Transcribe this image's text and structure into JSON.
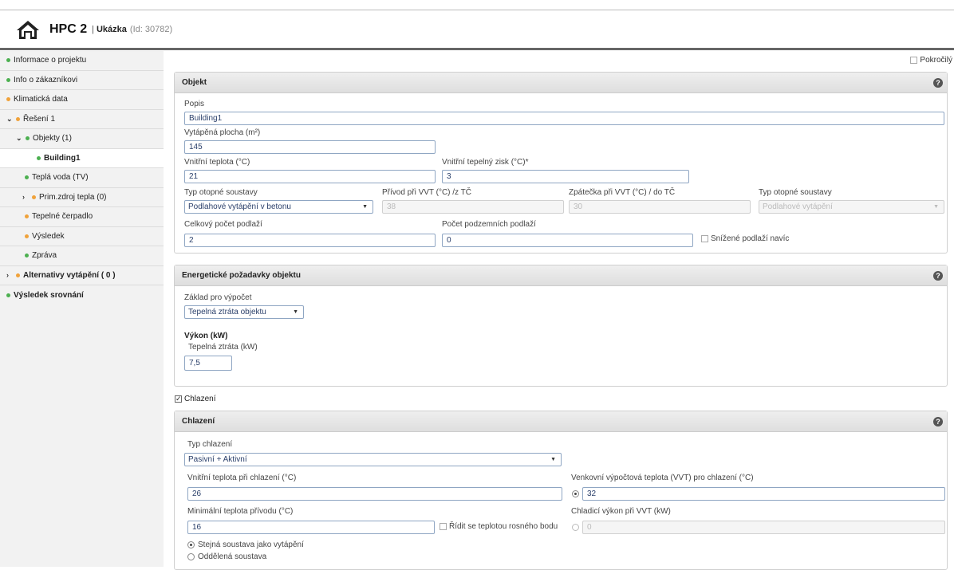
{
  "header": {
    "app_title": "HPC 2",
    "separator": "|",
    "project_name": "Ukázka",
    "project_id": "(Id: 30782)"
  },
  "sidebar": {
    "items": [
      {
        "label": "Informace o projektu",
        "dot": "green"
      },
      {
        "label": "Info o zákazníkovi",
        "dot": "green"
      },
      {
        "label": "Klimatická data",
        "dot": "orange"
      },
      {
        "label": "Řešení 1",
        "dot": "orange",
        "expanded": true
      },
      {
        "label": "Objekty (1)",
        "dot": "green",
        "expanded": true
      },
      {
        "label": "Building1",
        "dot": "green",
        "selected": true
      },
      {
        "label": "Teplá voda (TV)",
        "dot": "green"
      },
      {
        "label": "Prim.zdroj tepla (0)",
        "dot": "orange",
        "expanded": false
      },
      {
        "label": "Tepelné čerpadlo",
        "dot": "orange"
      },
      {
        "label": "Výsledek",
        "dot": "orange"
      },
      {
        "label": "Zpráva",
        "dot": "green"
      },
      {
        "label": "Alternativy vytápění ( 0 )",
        "dot": "orange",
        "expanded": false
      },
      {
        "label": "Výsledek srovnání",
        "dot": "green"
      }
    ]
  },
  "advanced": {
    "label": "Pokročilý",
    "checked": false
  },
  "objekt": {
    "title": "Objekt",
    "popis_label": "Popis",
    "popis_value": "Building1",
    "plocha_label": "Vytápěná plocha (m²)",
    "plocha_value": "145",
    "vnitrni_teplota_label": "Vnitřní teplota (°C)",
    "vnitrni_teplota_value": "21",
    "zisk_label": "Vnitřní tepelný zisk (°C)*",
    "zisk_value": "3",
    "typ_soustavy_label": "Typ otopné soustavy",
    "typ_soustavy_value": "Podlahové vytápění v betonu",
    "privod_label": "Přívod při VVT (°C) /z TČ",
    "privod_value": "38",
    "zpatecka_label": "Zpátečka při VVT (°C) / do TČ",
    "zpatecka_value": "30",
    "typ_soustavy2_label": "Typ otopné soustavy",
    "typ_soustavy2_value": "Podlahové vytápění",
    "podlazi_label": "Celkový počet podlaží",
    "podlazi_value": "2",
    "podzemni_label": "Počet podzemních podlaží",
    "podzemni_value": "0",
    "snizene_label": "Snížené podlaží navíc",
    "snizene_checked": false
  },
  "energie": {
    "title": "Energetické požadavky objektu",
    "zaklad_label": "Základ pro výpočet",
    "zaklad_value": "Tepelná ztráta objektu",
    "vykon_label": "Výkon (kW)",
    "ztrata_label": "Tepelná ztráta (kW)",
    "ztrata_value": "7,5"
  },
  "chlazeni_toggle": {
    "label": "Chlazení",
    "checked": true
  },
  "chlazeni": {
    "title": "Chlazení",
    "typ_label": "Typ chlazení",
    "typ_value": "Pasivní + Aktivní",
    "vnitrni_label": "Vnitřní teplota při chlazení (°C)",
    "vnitrni_value": "26",
    "venkovni_label": "Venkovní výpočtová teplota (VVT) pro chlazení (°C)",
    "venkovni_value": "32",
    "min_privod_label": "Minimální teplota přívodu (°C)",
    "min_privod_value": "16",
    "ridit_label": "Řídit se teplotou rosného bodu",
    "ridit_checked": false,
    "vykon_label": "Chladicí výkon při VVT (kW)",
    "vykon_value": "0",
    "radio_stejna": "Stejná soustava jako vytápění",
    "radio_oddelena": "Oddělená soustava"
  },
  "colors": {
    "green": "#4cb050",
    "orange": "#f0a23a",
    "input_border": "#8fa6c3"
  },
  "icons": [
    "home-icon",
    "help-icon",
    "chevron-down-icon",
    "chevron-right-icon"
  ]
}
